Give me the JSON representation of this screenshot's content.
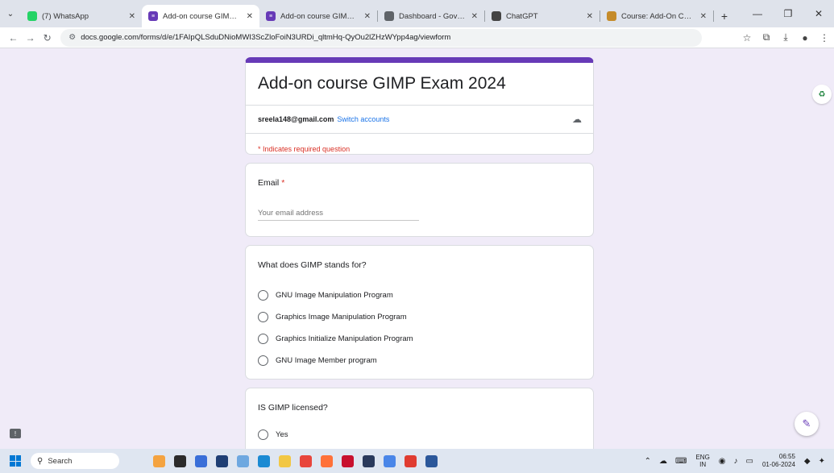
{
  "browser": {
    "tabs": [
      {
        "title": "(7) WhatsApp",
        "icon": "whatsapp-icon",
        "color": "#25d366",
        "active": false
      },
      {
        "title": "Add-on course GIMP Exam",
        "icon": "forms-icon",
        "color": "#673ab7",
        "active": true
      },
      {
        "title": "Add-on course GIMP Exam",
        "icon": "forms-icon",
        "color": "#673ab7",
        "active": false
      },
      {
        "title": "Dashboard - Government",
        "icon": "gov-icon",
        "color": "#5f6368",
        "active": false
      },
      {
        "title": "ChatGPT",
        "icon": "chatgpt-icon",
        "color": "#444444",
        "active": false
      },
      {
        "title": "Course: Add-On Course in",
        "icon": "course-icon",
        "color": "#c58b2a",
        "active": false
      }
    ],
    "url": "docs.google.com/forms/d/e/1FAIpQLSduDNioMWI3ScZloFoiN3URDi_qltmHq-QyOu2lZHzWYpp4ag/viewform"
  },
  "form": {
    "title": "Add-on course GIMP Exam 2024",
    "account_email": "sreela148@gmail.com",
    "switch_label": "Switch accounts",
    "required_note": "* Indicates required question",
    "accent": "#673ab7",
    "email_question": {
      "label": "Email",
      "required_mark": "*",
      "placeholder": "Your email address"
    },
    "questions": [
      {
        "label": "What does GIMP stands for?",
        "options": [
          "GNU Image Manipulation Program",
          "Graphics Image Manipulation Program",
          "Graphics Initialize Manipulation Program",
          "GNU Image Member program"
        ]
      },
      {
        "label": "IS GIMP licensed?",
        "options": [
          "Yes"
        ]
      }
    ]
  },
  "taskbar": {
    "search_label": "Search",
    "lang_top": "ENG",
    "lang_bottom": "IN",
    "time": "06:55",
    "date": "01-06-2024"
  }
}
